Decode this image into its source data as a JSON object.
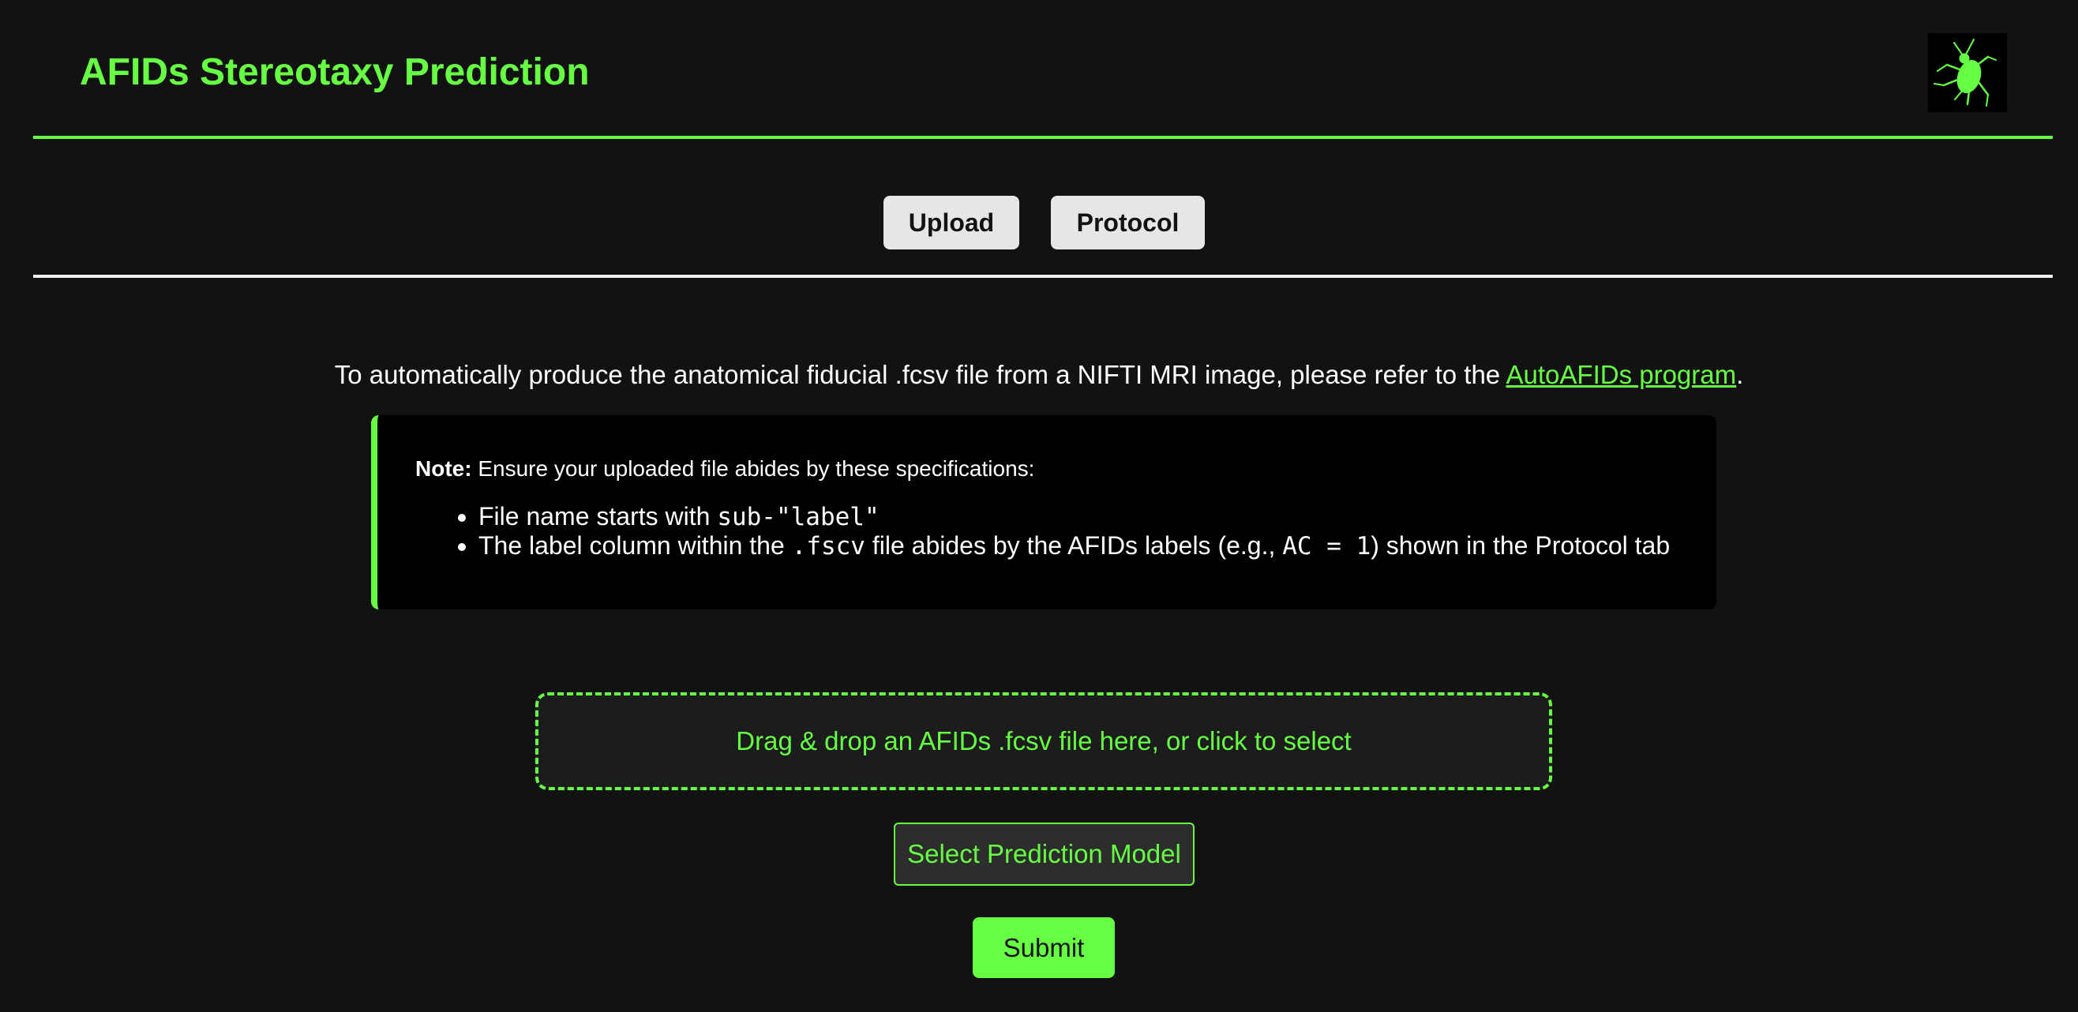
{
  "header": {
    "title": "AFIDs Stereotaxy Prediction",
    "logo_icon": "insect-logo-icon"
  },
  "tabs": [
    {
      "label": "Upload"
    },
    {
      "label": "Protocol"
    }
  ],
  "intro": {
    "text": "To automatically produce the anatomical fiducial .fcsv file from a NIFTI MRI image, please refer to the ",
    "link_text": "AutoAFIDs program",
    "suffix": "."
  },
  "note": {
    "label": "Note:",
    "text": " Ensure your uploaded file abides by these specifications:",
    "item1_text": "File name starts with ",
    "item1_code": "sub-\"label\"",
    "item2_text_a": "The label column within the ",
    "item2_code_a": ".fscv",
    "item2_text_b": " file abides by the AFIDs labels (e.g., ",
    "item2_code_b": "AC = 1",
    "item2_text_c": ") shown in the Protocol tab"
  },
  "dropzone": {
    "text": "Drag & drop an AFIDs .fcsv file here, or click to select"
  },
  "model_select": {
    "label": "Select Prediction Model"
  },
  "submit": {
    "label": "Submit"
  },
  "colors": {
    "accent": "#66ff44",
    "background": "#121212",
    "note_bg": "#000000",
    "tab_bg": "#e6e6e6"
  }
}
